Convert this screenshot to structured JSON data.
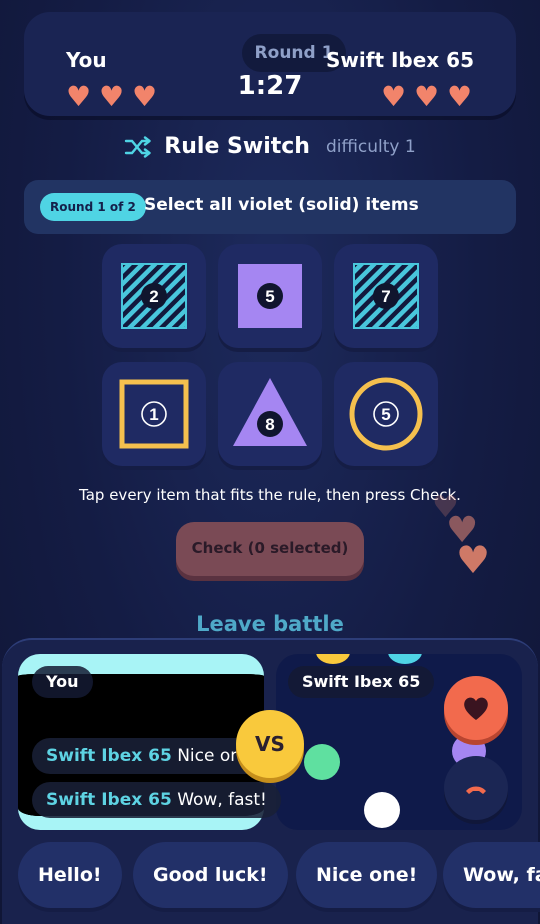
{
  "header": {
    "round_label": "Round 1",
    "you_name": "You",
    "opponent_name": "Swift Ibex 65",
    "timer": "1:27",
    "you_lives": 3,
    "opponent_lives": 3
  },
  "game": {
    "title": "Rule Switch",
    "difficulty": "difficulty 1",
    "round_badge": "Round 1 of 2",
    "rule": "Select all violet (solid) items",
    "tiles": [
      {
        "shape": "square",
        "fill": "striped",
        "color": "#49c6dc",
        "number": "2"
      },
      {
        "shape": "square",
        "fill": "solid",
        "color": "#a586f2",
        "number": "5"
      },
      {
        "shape": "square",
        "fill": "striped",
        "color": "#49c6dc",
        "number": "7"
      },
      {
        "shape": "square",
        "fill": "outline",
        "color": "#f5c04e",
        "number": "1"
      },
      {
        "shape": "triangle",
        "fill": "solid",
        "color": "#a586f2",
        "number": "8"
      },
      {
        "shape": "circle",
        "fill": "outline",
        "color": "#f5c04e",
        "number": "5"
      }
    ],
    "instruction": "Tap every item that fits the rule, then press Check.",
    "check_button": "Check (0 selected)",
    "leave_button": "Leave battle"
  },
  "video": {
    "you_label": "You",
    "opponent_label": "Swift Ibex 65",
    "vs_label": "VS",
    "chat": [
      {
        "who": "Swift Ibex 65",
        "text": "Nice one!"
      },
      {
        "who": "Swift Ibex 65",
        "text": "Wow, fast!"
      }
    ]
  },
  "quick_replies": [
    "Hello!",
    "Good luck!",
    "Nice one!",
    "Wow, fast!"
  ],
  "colors": {
    "accent_cyan": "#4fd4e4",
    "heart": "#f2846b",
    "violet": "#a586f2",
    "yellow": "#f5c04e"
  }
}
